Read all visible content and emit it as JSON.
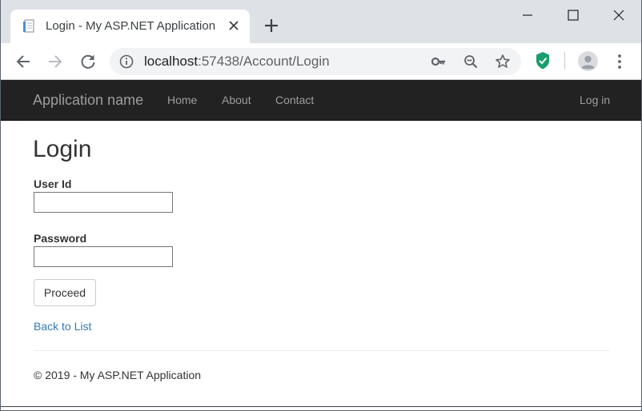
{
  "browser": {
    "tab": {
      "title": "Login - My ASP.NET Application",
      "favicon": "document-icon",
      "close_icon": "close-icon"
    },
    "new_tab_icon": "plus-icon",
    "window_controls": {
      "minimize": "minimize-icon",
      "maximize": "maximize-icon",
      "close": "close-icon"
    },
    "toolbar": {
      "back_icon": "arrow-left-icon",
      "forward_icon": "arrow-right-icon",
      "reload_icon": "reload-icon",
      "site_info_icon": "info-icon",
      "url_host": "localhost",
      "url_rest": ":57438/Account/Login",
      "key_icon": "key-icon",
      "zoom_icon": "zoom-out-icon",
      "bookmark_icon": "star-icon",
      "extension_icon": "shield-check-icon",
      "profile_icon": "avatar-icon",
      "menu_icon": "kebab-menu-icon"
    }
  },
  "navbar": {
    "brand": "Application name",
    "links": [
      "Home",
      "About",
      "Contact"
    ],
    "login": "Log in"
  },
  "main": {
    "title": "Login",
    "user_id_label": "User Id",
    "user_id_value": "",
    "password_label": "Password",
    "password_value": "",
    "proceed_button": "Proceed",
    "back_link": "Back to List"
  },
  "footer": {
    "text": "© 2019 - My ASP.NET Application"
  },
  "colors": {
    "navbar_bg": "#222222",
    "navbar_text": "#9d9d9d",
    "link": "#337ab7",
    "tabstrip_bg": "#dee1e6",
    "extension_green": "#1a9f6c"
  }
}
